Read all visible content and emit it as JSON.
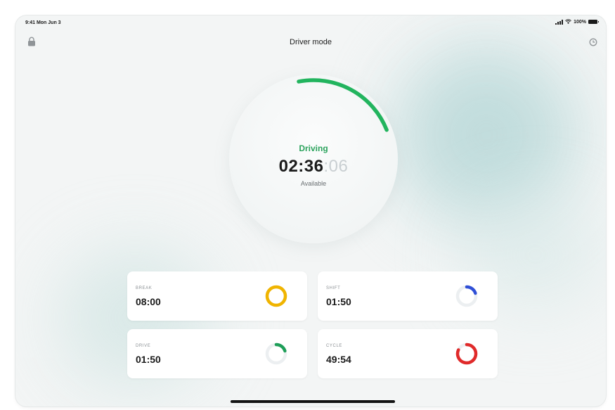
{
  "status_bar": {
    "time": "9:41 Mon Jun 3",
    "battery": "100%"
  },
  "header": {
    "title": "Driver mode",
    "left_icon": "lock-icon",
    "right_icon": "history-icon"
  },
  "dial": {
    "status": "Driving",
    "time_main": "02:36",
    "time_seconds": ":06",
    "sub_label": "Available",
    "progress": 0.22,
    "color": "#22b45e"
  },
  "cards": [
    {
      "label": "BREAK",
      "value": "08:00",
      "ring_color": "#f0b400",
      "ring_progress": 1.0
    },
    {
      "label": "SHIFT",
      "value": "01:50",
      "ring_color": "#2f4fd6",
      "ring_progress": 0.2
    },
    {
      "label": "DRIVE",
      "value": "01:50",
      "ring_color": "#1e9e58",
      "ring_progress": 0.2
    },
    {
      "label": "CYCLE",
      "value": "49:54",
      "ring_color": "#e02a2a",
      "ring_progress": 0.82
    }
  ],
  "colors": {
    "track": "#eceff1"
  }
}
